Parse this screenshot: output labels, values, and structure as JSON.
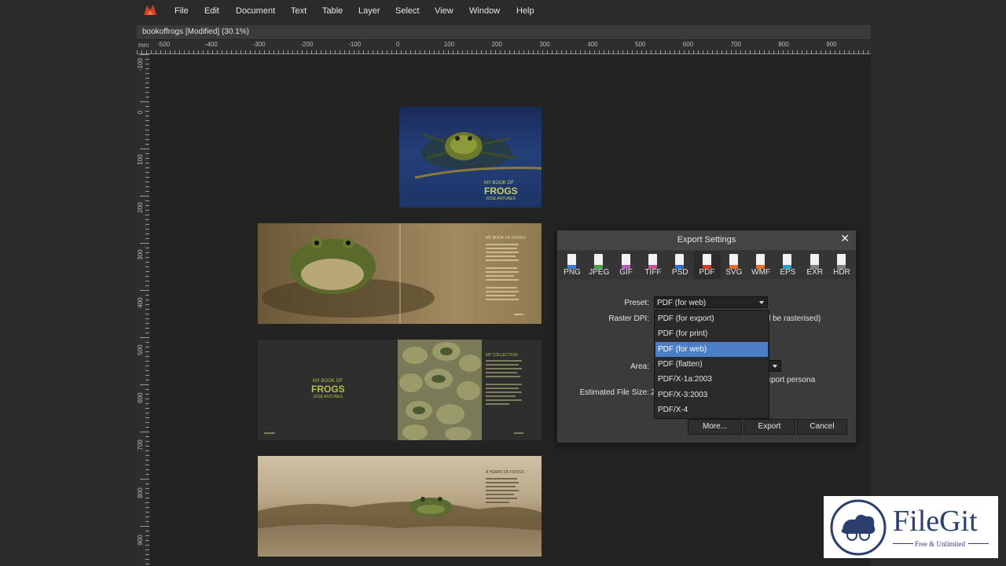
{
  "menu": [
    "File",
    "Edit",
    "Document",
    "Text",
    "Table",
    "Layer",
    "Select",
    "View",
    "Window",
    "Help"
  ],
  "document_tab": "bookoffrogs [Modified] (30.1%)",
  "ruler": {
    "unit": "mm",
    "h_ticks": [
      "-500",
      "-400",
      "-300",
      "-200",
      "-100",
      "0",
      "100",
      "200",
      "300",
      "400",
      "500",
      "600",
      "700",
      "800",
      "900"
    ],
    "v_ticks": [
      "-100",
      "0",
      "100",
      "200",
      "300",
      "400",
      "500",
      "600",
      "700",
      "800",
      "900"
    ]
  },
  "pages": {
    "cover_title_1": "MY BOOK OF",
    "cover_title_2": "FROGS",
    "cover_author": "JOSE ANTUNES",
    "spread1_heading": "MY BOOK OF FROGS",
    "spread2_title_1": "MY BOOK OF",
    "spread2_title_2": "FROGS",
    "spread2_author": "JOSE ANTUNES",
    "spread2_heading": "MY COLLECTION",
    "spread3_heading": "A YEARS OF FROGS"
  },
  "dialog": {
    "title": "Export Settings",
    "formats": [
      "PNG",
      "JPEG",
      "GIF",
      "TIFF",
      "PSD",
      "PDF",
      "SVG",
      "WMF",
      "EPS",
      "EXR",
      "HDR"
    ],
    "active_format": "PDF",
    "format_colors": [
      "#3d7fd6",
      "#48a048",
      "#b858c0",
      "#d0509a",
      "#2f6fd0",
      "#d23a2a",
      "#e07030",
      "#e07030",
      "#2aa0c8",
      "#808080",
      "#808080"
    ],
    "preset_label": "Preset:",
    "preset_value": "PDF (for web)",
    "raster_label": "Raster DPI:",
    "raster_hint": "ll be rasterised)",
    "area_label": "Area:",
    "persona_hint": "xport persona",
    "size_label": "Estimated File Size:",
    "size_value": "2",
    "preset_options": [
      "PDF (for export)",
      "PDF (for print)",
      "PDF (for web)",
      "PDF (flatten)",
      "PDF/X-1a:2003",
      "PDF/X-3:2003",
      "PDF/X-4"
    ],
    "selected_option": "PDF (for web)",
    "buttons": {
      "more": "More...",
      "export": "Export",
      "cancel": "Cancel"
    }
  },
  "watermark": {
    "brand": "FileGit",
    "tagline": "Free & Unlimited"
  }
}
